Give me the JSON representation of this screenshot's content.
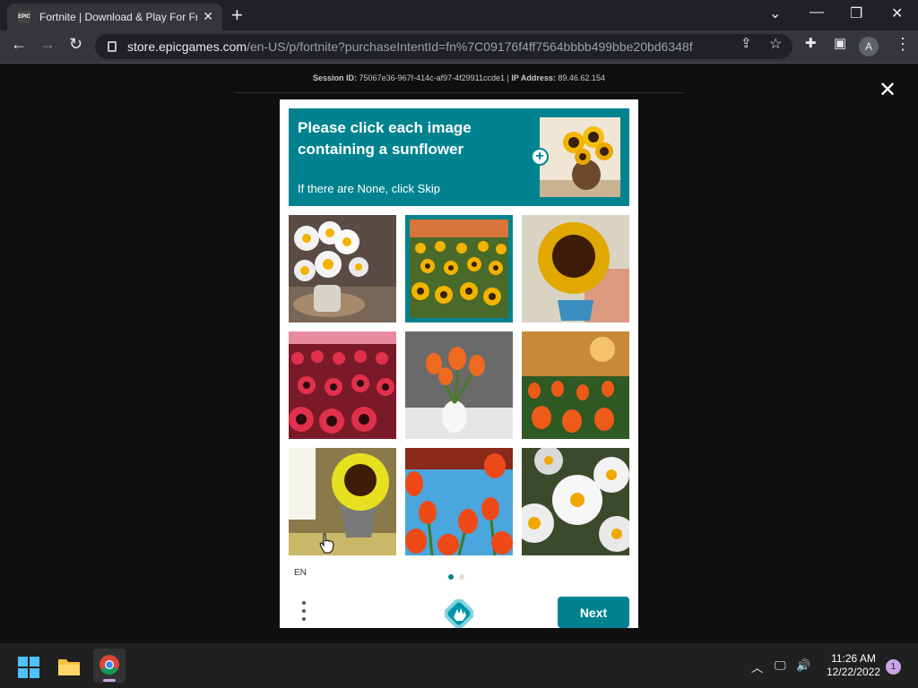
{
  "browser": {
    "tab_title": "Fortnite | Download & Play For Free",
    "favicon_text": "EPIC",
    "new_tab": "+",
    "url_host": "store.epicgames.com",
    "url_path": "/en-US/p/fortnite?purchaseIntentId=fn%7C09176f4ff7564bbbb499bbe20bd6348f",
    "profile_initial": "A"
  },
  "session": {
    "session_label": "Session ID:",
    "session_id": "75067e36-967f-414c-af97-4f29911ccde1",
    "ip_label": "IP Address:",
    "ip": "89.46.62.154"
  },
  "challenge": {
    "prompt": "Please click each image containing a sunflower",
    "skip_hint": "If there are None, click Skip",
    "language": "EN",
    "next_label": "Next",
    "tiles": [
      {
        "name": "tile-daisies-vase",
        "selected": false
      },
      {
        "name": "tile-sunflower-field",
        "selected": true
      },
      {
        "name": "tile-sunflower-closeup",
        "selected": false
      },
      {
        "name": "tile-pink-flower-field",
        "selected": false
      },
      {
        "name": "tile-tulips-vase",
        "selected": false
      },
      {
        "name": "tile-tulip-field-sunset",
        "selected": false
      },
      {
        "name": "tile-sunflower-pot",
        "selected": false
      },
      {
        "name": "tile-tulips-sky",
        "selected": false
      },
      {
        "name": "tile-daisies-closeup",
        "selected": false
      }
    ],
    "page_dots": 2,
    "active_dot": 0
  },
  "taskbar": {
    "time": "11:26 AM",
    "date": "12/22/2022",
    "notifications": "1"
  },
  "colors": {
    "accent": "#00838f"
  }
}
